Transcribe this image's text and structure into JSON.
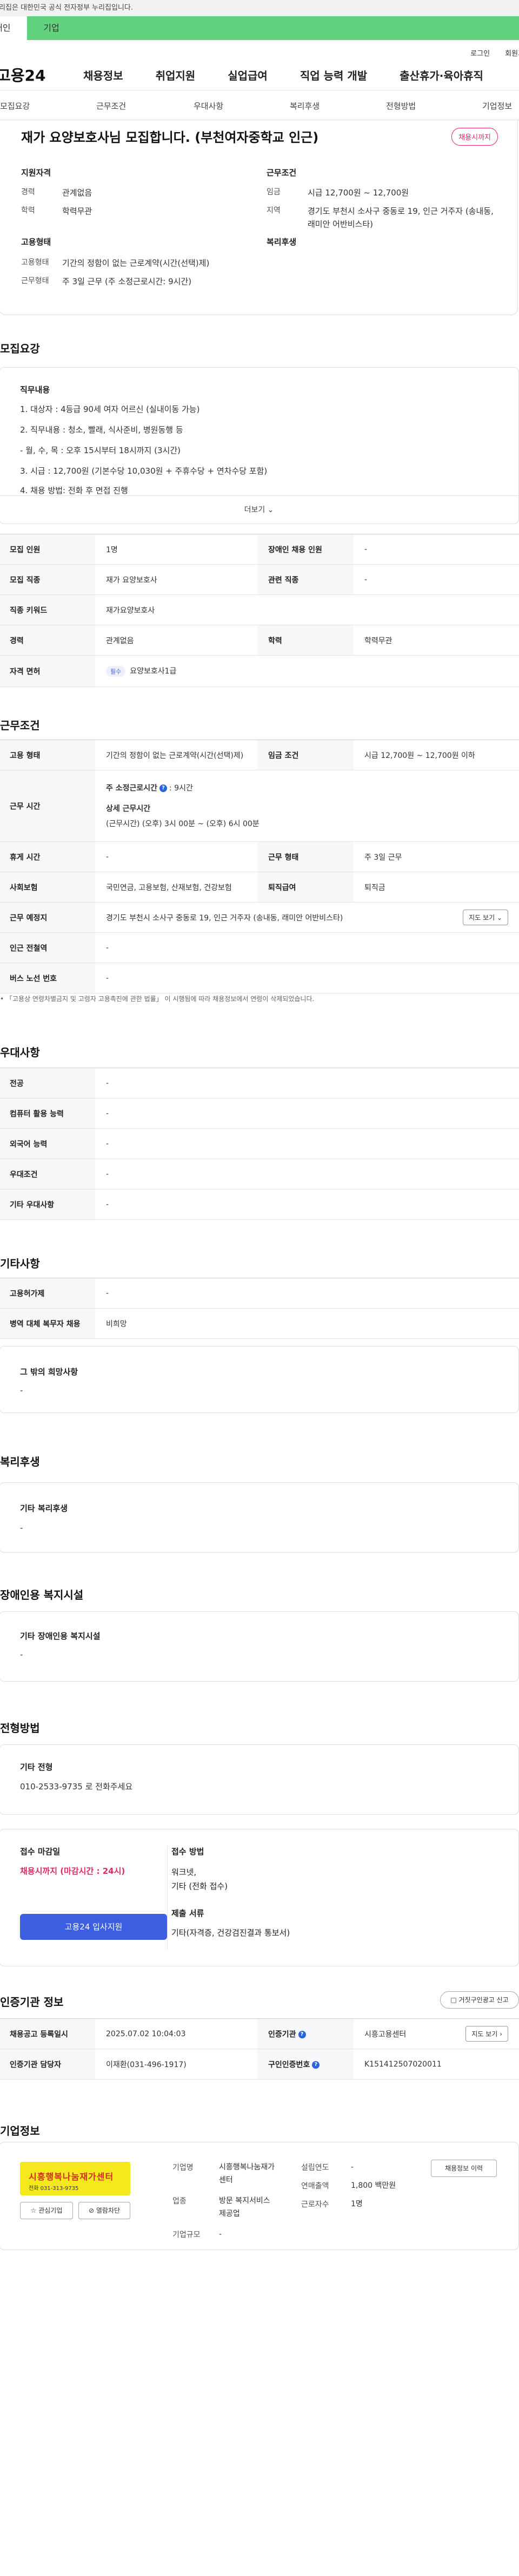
{
  "gov_notice": "이 누리집은 대한민국 공식 전자정부 누리집입니다.",
  "site_tabs": [
    "개인",
    "기업"
  ],
  "util": {
    "login": "로그인",
    "signup": "회원가입"
  },
  "logo": "고용24",
  "gnb": [
    "채용정보",
    "취업지원",
    "실업급여",
    "직업 능력 개발",
    "출산휴가·육아휴직"
  ],
  "sub_tabs": [
    "모집요강",
    "근무조건",
    "우대사항",
    "복리후생",
    "전형방법",
    "기업정보"
  ],
  "job": {
    "title": "재가 요양보호사님 모집합니다. (부천여자중학교 인근)",
    "badge": "채용시까지",
    "summary": {
      "qual_head": "지원자격",
      "career_k": "경력",
      "career_v": "관계없음",
      "edu_k": "학력",
      "edu_v": "학력무관",
      "emp_head": "고용형태",
      "type_k": "고용형태",
      "type_v": "기간의 정함이 없는 근로계약(시간(선택)제)",
      "form_k": "근무형태",
      "form_v": "주 3일 근무 (주 소정근로시간: 9시간)",
      "cond_head": "근무조건",
      "wage_k": "임금",
      "wage_v": "시급 12,700원 ~ 12,700원",
      "area_k": "지역",
      "area_v1": "경기도 부천시 소사구 중동로 19, 인근 거주자 (송내동,",
      "area_v2": "래미안 어반비스타)",
      "welfare_head": "복리후생"
    }
  },
  "recruit": {
    "title": "모집요강",
    "duty_head": "직무내용",
    "duty_lines": [
      "1. 대상자 : 4등급  90세 여자 어르신 (실내이동 가능)",
      "2. 직무내용 : 청소, 빨래, 식사준비, 병원동행  등",
      "  - 월,  수,  목 : 오후 15시부터  18시까지 (3시간)",
      "3. 시급 : 12,700원 (기본수당 10,030원 + 주휴수당 + 연차수당 포함)",
      "4. 채용 방법: 전화 후 면접 진행"
    ],
    "more": "더보기",
    "table": {
      "count_k": "모집 인원",
      "count_v": "1명",
      "dis_k": "장애인 채용 인원",
      "dis_v": "-",
      "job_k": "모집 직종",
      "job_v": "재가 요양보호사",
      "rel_k": "관련 직종",
      "rel_v": "-",
      "kw_k": "직종 키워드",
      "kw_v": "재가요양보호사",
      "career_k": "경력",
      "career_v": "관계없음",
      "edu_k": "학력",
      "edu_v": "학력무관",
      "lic_k": "자격 면허",
      "lic_chip": "필수",
      "lic_v": "요양보호사1급"
    }
  },
  "work": {
    "title": "근무조건",
    "type_k": "고용 형태",
    "type_v": "기간의 정함이 없는 근로계약(시간(선택)제)",
    "wage_k": "임금 조건",
    "wage_v": "시급 12,700원 ~ 12,700원 이하",
    "time_k": "근무 시간",
    "time_a": "주 소정근로시간",
    "time_a2": ": 9시간",
    "time_b": "상세 근무시간",
    "time_c": "(근무시간) (오후) 3시 00분 ~ (오후) 6시 00분",
    "rest_k": "휴게 시간",
    "rest_v": "-",
    "form_k": "근무 형태",
    "form_v": "주 3일 근무",
    "ins_k": "사회보험",
    "ins_v": "국민연금, 고용보험, 산재보험, 건강보험",
    "ret_k": "퇴직급여",
    "ret_v": "퇴직금",
    "place_k": "근무 예정지",
    "place_v": "경기도 부천시 소사구 중동로 19, 인근 거주자 (송내동, 래미안 어반비스타)",
    "map_btn": "지도 보기",
    "sub_k": "인근 전철역",
    "sub_v": "-",
    "bus_k": "버스 노선 번호",
    "bus_v": "-",
    "note": "「고용상 연령차별금지 및 고령자 고용촉진에 관한 법률」 이 시행됨에 따라 채용정보에서 연령이 삭제되었습니다."
  },
  "pref": {
    "title": "우대사항",
    "rows": [
      {
        "k": "전공",
        "v": "-"
      },
      {
        "k": "컴퓨터 활용 능력",
        "v": "-"
      },
      {
        "k": "외국어 능력",
        "v": "-"
      },
      {
        "k": "우대조건",
        "v": "-"
      },
      {
        "k": "기타 우대사항",
        "v": "-"
      }
    ]
  },
  "etc": {
    "title": "기타사항",
    "emp_k": "고용허가제",
    "emp_v": "-",
    "mil_k": "병역 대체 복무자 채용",
    "mil_v": "비희망",
    "wish_t": "그 밖의 희망사항",
    "wish_v": "-"
  },
  "welfare": {
    "title": "복리후생",
    "t": "기타 복리후생",
    "v": "-"
  },
  "disfac": {
    "title": "장애인용 복지시설",
    "t": "기타 장애인용 복지시설",
    "v": "-"
  },
  "sel": {
    "title": "전형방법",
    "t": "기타 전형",
    "v": "010-2533-9735 로 전화주세요"
  },
  "apply": {
    "deadline_t": "접수 마감일",
    "deadline_v": "채용시까지 (마감시간 : 24시)",
    "btn": "고용24 입사지원",
    "method_t": "접수 방법",
    "method_v1": "워크넷,",
    "method_v2": "기타 (전화 접수)",
    "docs_t": "제출 서류",
    "docs_v": "기타(자격증, 건강검진결과 통보서)"
  },
  "cert": {
    "title": "인증기관 정보",
    "report_btn": "거짓구인광고 신고",
    "reg_k": "채용공고 등록일시",
    "reg_v": "2025.07.02 10:04:03",
    "org_k": "인증기관",
    "org_v": "시흥고용센터",
    "map_btn": "지도 보기",
    "mgr_k": "인증기관 담당자",
    "mgr_v": "이재환(031-496-1917)",
    "no_k": "구인인증번호",
    "no_v": "K151412507020011"
  },
  "company": {
    "title": "기업정보",
    "logo_text": "시흥행복나눔재가센터",
    "logo_sub": "전화 031-313-9735",
    "fav_btn": "관심기업",
    "block_btn": "열람차단",
    "name_k": "기업명",
    "name_v1": "시흥행복나눔재가",
    "name_v2": "센터",
    "ind_k": "업종",
    "ind_v1": "방문 복지서비스",
    "ind_v2": "제공업",
    "size_k": "기업규모",
    "size_v": "-",
    "est_k": "설립연도",
    "est_v": "-",
    "sales_k": "연매출액",
    "sales_v": "1,800 백만원",
    "staff_k": "근로자수",
    "staff_v": "1명",
    "hist_btn": "채용정보 이력"
  }
}
